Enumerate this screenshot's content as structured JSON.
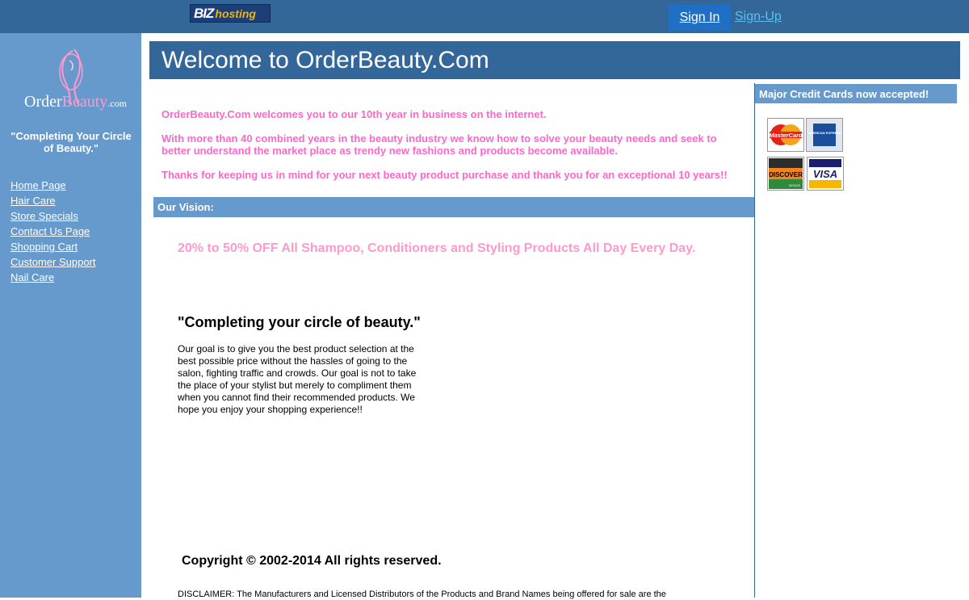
{
  "topbar": {
    "biz_logo": {
      "part1": "BIZ",
      "part2": "hosting"
    },
    "sign_in": "Sign In",
    "sign_up": "Sign-Up"
  },
  "sidebar": {
    "logo": {
      "order": "Order",
      "beauty": "Beauty",
      "com": ".com"
    },
    "tagline": "\"Completing Your Circle of Beauty.\"",
    "nav": [
      "Home Page",
      "Hair Care",
      "Store Specials",
      "Contact Us Page",
      "Shopping Cart",
      "Customer Support",
      "Nail Care"
    ]
  },
  "main": {
    "header": "Welcome to OrderBeauty.Com",
    "intro": [
      "OrderBeauty.Com welcomes you to our 10th year in business on the internet.",
      "With more than 40 combined years in the beauty industry we know how to solve your beauty needs and seek to better understand the market place as trendy new fashions and products become available.",
      "Thanks for keeping us in mind for your next beauty product purchase and thank you for an exceptional 10 years!!"
    ],
    "vision_title": "Our Vision:",
    "promo": "20% to 50% OFF All Shampoo, Conditioners and Styling Products All Day Every Day.",
    "quote_title": "\"Completing your circle of beauty.\"",
    "goal": "Our goal is to give you the best product selection at the best possible price without the hassles of going to the salon, fighting traffic and crowds. Our goal is not to take the place of your stylist but merely to compliment them when you cannot find their recommended products. We hope you enjoy your shopping experience!!",
    "copyright": "Copyright © 2002-2014 All rights reserved.",
    "disclaimer": "DISCLAIMER: The Manufacturers and Licensed Distributors of the Products and Brand Names being offered for sale are the"
  },
  "right": {
    "cc_title": "Major Credit Cards now accepted!",
    "cards": {
      "mastercard": "MasterCard",
      "amex": "AMERICAN EXPRESS",
      "discover": "DISCOVER",
      "discover_sub": "NOVUS",
      "visa": "VISA"
    }
  },
  "colors": {
    "topbar": "#336699",
    "sidebar": "#6699cc",
    "accent_pink": "#ff66cc",
    "promo_pink": "#ff99cc"
  }
}
